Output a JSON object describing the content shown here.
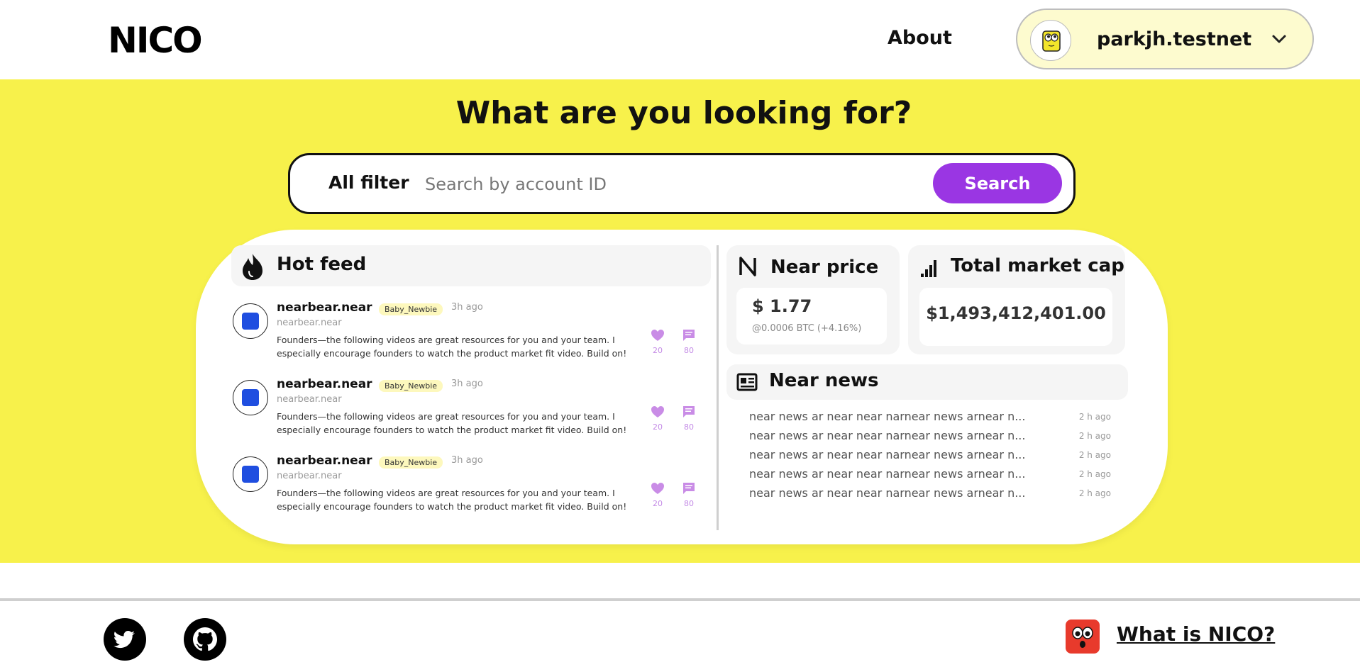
{
  "header": {
    "logo": "NICO",
    "about_label": "About",
    "account_name": "parkjh.testnet"
  },
  "hero": {
    "title": "What are you looking for?",
    "filter_label": "All filter",
    "search_placeholder": "Search by account ID",
    "search_button": "Search"
  },
  "hot_feed": {
    "title": "Hot feed",
    "items": [
      {
        "name": "nearbear.near",
        "badge": "Baby_Newbie",
        "time": "3h ago",
        "handle": "nearbear.near",
        "text": "Founders—the following videos are great resources for you and your team. I especially encourage founders to watch the product market fit video. Build on!",
        "likes": "20",
        "comments": "80"
      },
      {
        "name": "nearbear.near",
        "badge": "Baby_Newbie",
        "time": "3h ago",
        "handle": "nearbear.near",
        "text": "Founders—the following videos are great resources for you and your team. I especially encourage founders to watch the product market fit video. Build on!",
        "likes": "20",
        "comments": "80"
      },
      {
        "name": "nearbear.near",
        "badge": "Baby_Newbie",
        "time": "3h ago",
        "handle": "nearbear.near",
        "text": "Founders—the following videos are great resources for you and your team. I especially encourage founders to watch the product market fit video. Build on!",
        "likes": "20",
        "comments": "80"
      }
    ]
  },
  "near_price": {
    "title": "Near price",
    "value": "$ 1.77",
    "sub": "@0.0006 BTC (+4.16%)"
  },
  "market_cap": {
    "title": "Total market cap",
    "value": "$1,493,412,401.00"
  },
  "near_news": {
    "title": "Near news",
    "items": [
      {
        "text": "near news ar near near narnear news arnear n...",
        "time": "2 h ago"
      },
      {
        "text": "near news ar near near narnear news arnear n...",
        "time": "2 h ago"
      },
      {
        "text": "near news ar near near narnear news arnear n...",
        "time": "2 h ago"
      },
      {
        "text": "near news ar near near narnear news arnear n...",
        "time": "2 h ago"
      },
      {
        "text": "near news ar near near narnear news arnear n...",
        "time": "2 h ago"
      }
    ]
  },
  "footer": {
    "what_is_label": "What is NICO?"
  },
  "colors": {
    "brand_yellow": "#f7f14b",
    "accent_purple": "#9a36e3",
    "pill_bg": "#fdfbcf"
  }
}
